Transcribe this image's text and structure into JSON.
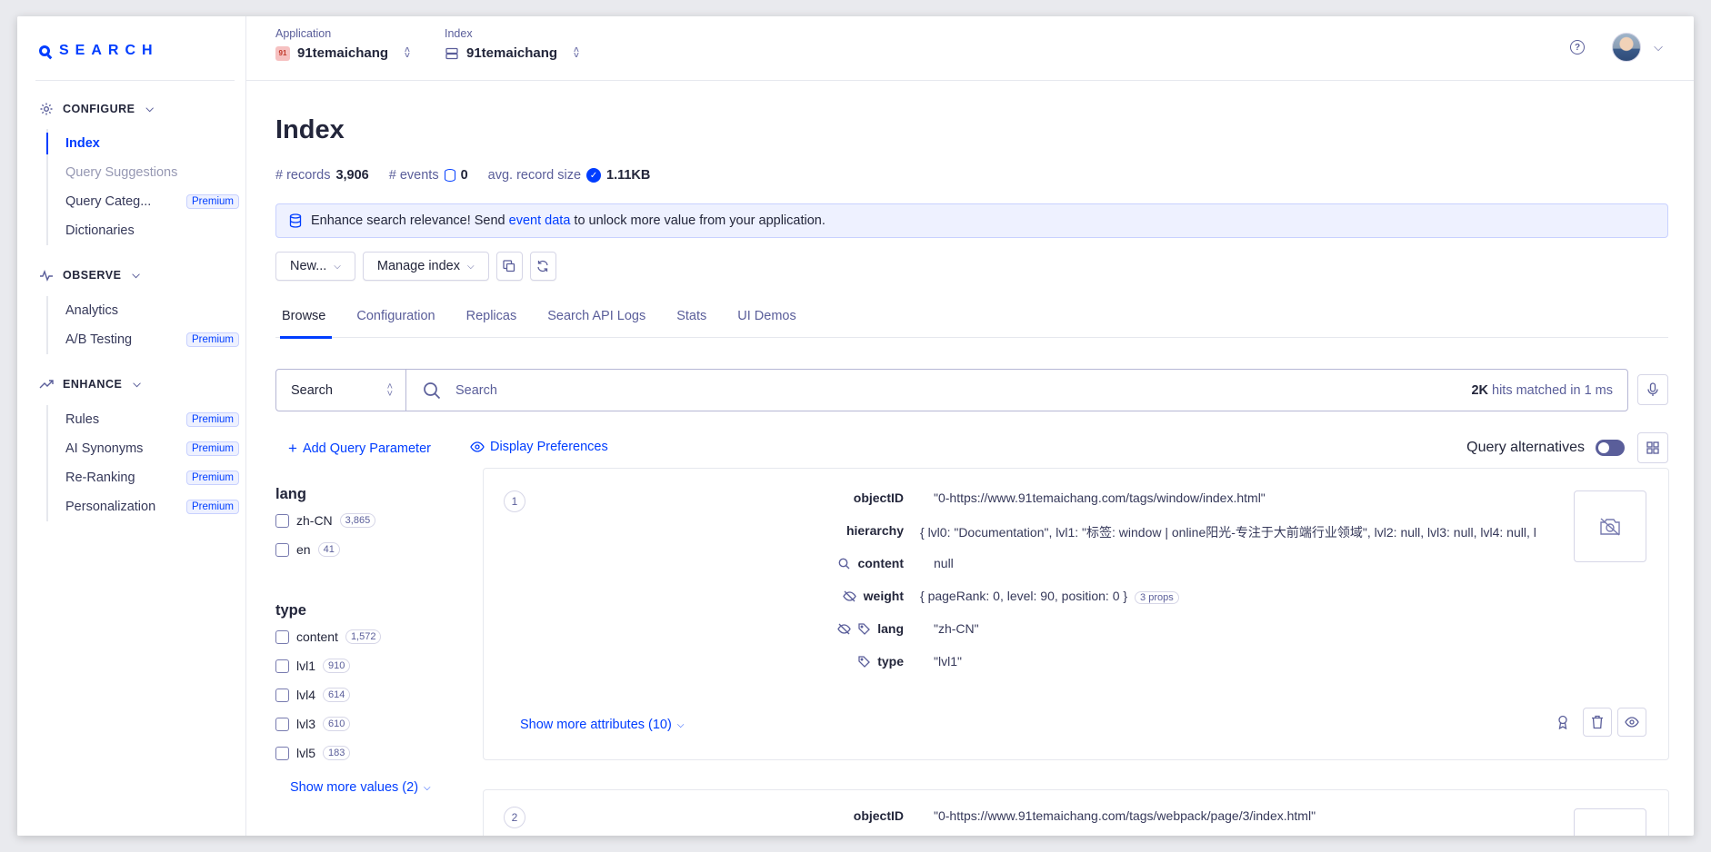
{
  "brand": {
    "logo_text": "SEARCH",
    "accent": "#003dff"
  },
  "sidebar": {
    "sections": [
      {
        "title": "CONFIGURE",
        "icon": "gear-icon"
      },
      {
        "title": "OBSERVE",
        "icon": "pulse-icon"
      },
      {
        "title": "ENHANCE",
        "icon": "trend-up-icon"
      }
    ],
    "configure_items": [
      {
        "label": "Index"
      },
      {
        "label": "Query Suggestions"
      },
      {
        "label": "Query Categ...",
        "badge": "Premium"
      },
      {
        "label": "Dictionaries"
      }
    ],
    "observe_items": [
      {
        "label": "Analytics"
      },
      {
        "label": "A/B Testing",
        "badge": "Premium"
      }
    ],
    "enhance_items": [
      {
        "label": "Rules",
        "badge": "Premium"
      },
      {
        "label": "AI Synonyms",
        "badge": "Premium"
      },
      {
        "label": "Re-Ranking",
        "badge": "Premium"
      },
      {
        "label": "Personalization",
        "badge": "Premium"
      }
    ]
  },
  "topbar": {
    "application_label": "Application",
    "application_value": "91temaichang",
    "application_badge": "91",
    "index_label": "Index",
    "index_value": "91temaichang"
  },
  "page": {
    "title": "Index",
    "records_label": "# records",
    "records_value": "3,906",
    "events_label": "# events",
    "events_value": "0",
    "avg_label": "avg. record size",
    "avg_value": "1.11KB"
  },
  "banner": {
    "text_before": "Enhance search relevance! Send",
    "link": "event data",
    "text_after": "to unlock more value from your application."
  },
  "toolbar": {
    "new_label": "New...",
    "manage_label": "Manage index"
  },
  "tabs": [
    "Browse",
    "Configuration",
    "Replicas",
    "Search API Logs",
    "Stats",
    "UI Demos"
  ],
  "search": {
    "type_value": "Search",
    "placeholder": "Search",
    "hits_count": "2K",
    "hits_text": "hits matched in 1 ms"
  },
  "links": {
    "add_query": "Add Query Parameter",
    "display_prefs": "Display Preferences",
    "query_alternatives": "Query alternatives"
  },
  "facets": {
    "lang_title": "lang",
    "lang": [
      {
        "label": "zh-CN",
        "count": "3,865"
      },
      {
        "label": "en",
        "count": "41"
      }
    ],
    "type_title": "type",
    "type": [
      {
        "label": "content",
        "count": "1,572"
      },
      {
        "label": "lvl1",
        "count": "910"
      },
      {
        "label": "lvl4",
        "count": "614"
      },
      {
        "label": "lvl3",
        "count": "610"
      },
      {
        "label": "lvl5",
        "count": "183"
      }
    ],
    "show_more": "Show more values (2)"
  },
  "hits": [
    {
      "number": "1",
      "attributes": [
        {
          "name": "objectID",
          "value": "\"0-https://www.91temaichang.com/tags/window/index.html\""
        },
        {
          "name": "hierarchy",
          "value": "{ lvl0: \"Documentation\", lvl1: \"标签: window | online阳光-专注于大前端行业领域\", lvl2: null, lvl3: null, lvl4: null, l"
        },
        {
          "name": "content",
          "value": "null"
        },
        {
          "name": "weight",
          "value": "{ pageRank: 0, level: 90, position: 0 }",
          "badge": "3 props"
        },
        {
          "name": "lang",
          "value": "\"zh-CN\""
        },
        {
          "name": "type",
          "value": "\"lvl1\""
        }
      ],
      "show_more": "Show more attributes (10)"
    },
    {
      "number": "2",
      "attributes": [
        {
          "name": "objectID",
          "value": "\"0-https://www.91temaichang.com/tags/webpack/page/3/index.html\""
        }
      ]
    }
  ]
}
